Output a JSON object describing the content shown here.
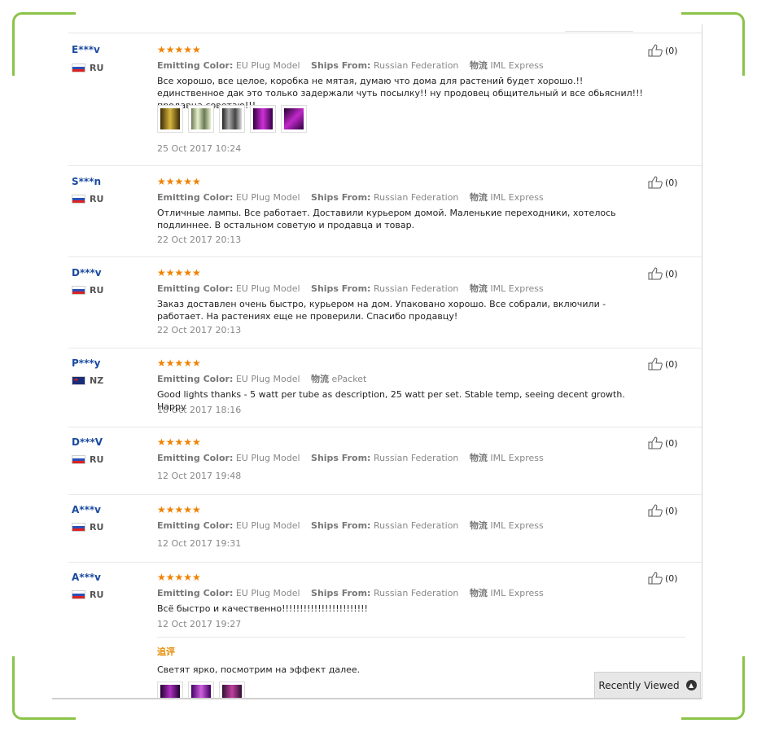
{
  "labels": {
    "emitting_color": "Emitting Color:",
    "ships_from": "Ships From:",
    "logistics": "物流"
  },
  "reviews": [
    {
      "user": "E***v",
      "country": "RU",
      "flag": "ru",
      "stars": "★★★★★",
      "emitting_color": "EU Plug Model",
      "ships_from": "Russian Federation",
      "logistics": "IML Express",
      "text": "Все хорошо, все целое, коробка не мятая, думаю что дома для растений будет хорошо.!! единственное дак это только задержали чуть посылку!! ну продовец общительный и все обьяснил!!! продавца советаю!!!",
      "date": "25 Oct 2017 10:24",
      "helpful": "(0)"
    },
    {
      "user": "S***n",
      "country": "RU",
      "flag": "ru",
      "stars": "★★★★★",
      "emitting_color": "EU Plug Model",
      "ships_from": "Russian Federation",
      "logistics": "IML Express",
      "text": "Отличные лампы. Все работает. Доставили курьером домой. Маленькие переходники, хотелось подлиннее. В остальном советую и продавца и товар.",
      "date": "22 Oct 2017 20:13",
      "helpful": "(0)"
    },
    {
      "user": "D***v",
      "country": "RU",
      "flag": "ru",
      "stars": "★★★★★",
      "emitting_color": "EU Plug Model",
      "ships_from": "Russian Federation",
      "logistics": "IML Express",
      "text": "Заказ доставлен очень быстро, курьером на дом. Упаковано хорошо. Все собрали, включили - работает. На растениях еще не проверили. Спасибо продавцу!",
      "date": "22 Oct 2017 20:13",
      "helpful": "(0)"
    },
    {
      "user": "P***y",
      "country": "NZ",
      "flag": "nz",
      "stars": "★★★★★",
      "emitting_color": "EU Plug Model",
      "logistics": "ePacket",
      "text": "Good lights thanks - 5 watt per tube as description, 25 watt per set. Stable temp, seeing decent growth. Happy",
      "date": "18 Oct 2017 18:16",
      "helpful": "(0)"
    },
    {
      "user": "D***V",
      "country": "RU",
      "flag": "ru",
      "stars": "★★★★★",
      "emitting_color": "EU Plug Model",
      "ships_from": "Russian Federation",
      "logistics": "IML Express",
      "date": "12 Oct 2017 19:48",
      "helpful": "(0)"
    },
    {
      "user": "A***v",
      "country": "RU",
      "flag": "ru",
      "stars": "★★★★★",
      "emitting_color": "EU Plug Model",
      "ships_from": "Russian Federation",
      "logistics": "IML Express",
      "date": "12 Oct 2017 19:31",
      "helpful": "(0)"
    },
    {
      "user": "A***v",
      "country": "RU",
      "flag": "ru",
      "stars": "★★★★★",
      "emitting_color": "EU Plug Model",
      "ships_from": "Russian Federation",
      "logistics": "IML Express",
      "text": "Всё быстро и качественно!!!!!!!!!!!!!!!!!!!!!!!!",
      "date": "12 Oct 2017 19:27",
      "helpful": "(0)",
      "followup_title": "追评",
      "followup_text": "Светят ярко, посмотрим на эффект далее."
    }
  ],
  "recently_viewed": "Recently Viewed",
  "colors": {
    "accent_green": "#8bc34a",
    "star_orange": "#f08200",
    "user_blue": "#1a4aa0"
  },
  "icons": [
    "thumbs-up-icon",
    "chevron-up-icon",
    "star-icon",
    "flag-icon"
  ]
}
